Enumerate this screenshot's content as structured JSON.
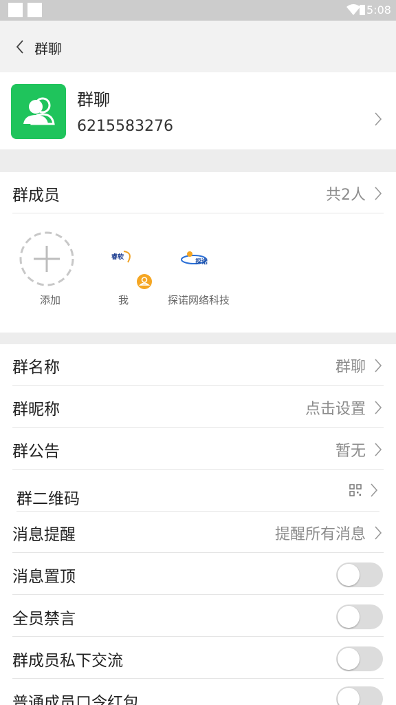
{
  "status_bar": {
    "time": "5:08"
  },
  "app_bar": {
    "title": "群聊"
  },
  "group": {
    "name": "群聊",
    "id": "6215583276"
  },
  "members_section": {
    "label": "群成员",
    "count": "共2人",
    "members": [
      {
        "label": "添加"
      },
      {
        "label": "我",
        "logo_text": "睿软"
      },
      {
        "label": "探诺网络科技",
        "logo_text": "探诺"
      }
    ]
  },
  "settings": [
    {
      "label": "群名称",
      "value": "群聊"
    },
    {
      "label": "群昵称",
      "value": "点击设置"
    },
    {
      "label": "群公告",
      "value": "暂无"
    },
    {
      "label": "群二维码",
      "value": "",
      "icon": "qr-code-icon"
    },
    {
      "label": "消息提醒",
      "value": "提醒所有消息"
    }
  ],
  "toggles": [
    {
      "label": "消息置顶",
      "on": false
    },
    {
      "label": "全员禁言",
      "on": false
    },
    {
      "label": "群成员私下交流",
      "on": false
    },
    {
      "label": "普通成员口令红包",
      "on": false
    }
  ],
  "colors": {
    "accent_green": "#1fc45c",
    "badge_orange": "#f5a623"
  }
}
